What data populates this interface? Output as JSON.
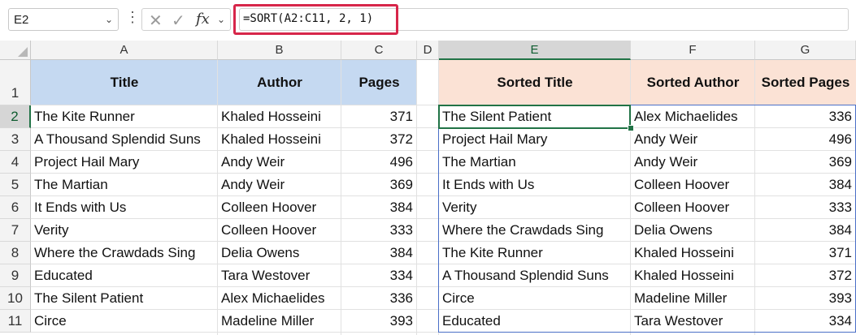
{
  "formula_bar": {
    "name_box": "E2",
    "formula": "=SORT(A2:C11, 2, 1)",
    "fx_label": "fx"
  },
  "columns": [
    "A",
    "B",
    "C",
    "D",
    "E",
    "F",
    "G"
  ],
  "rows": [
    "1",
    "2",
    "3",
    "4",
    "5",
    "6",
    "7",
    "8",
    "9",
    "10",
    "11"
  ],
  "source_table": {
    "headers": [
      "Title",
      "Author",
      "Pages"
    ],
    "rows": [
      [
        "The Kite Runner",
        "Khaled Hosseini",
        "371"
      ],
      [
        "A Thousand Splendid Suns",
        "Khaled Hosseini",
        "372"
      ],
      [
        "Project Hail Mary",
        "Andy Weir",
        "496"
      ],
      [
        "The Martian",
        "Andy Weir",
        "369"
      ],
      [
        "It Ends with Us",
        "Colleen Hoover",
        "384"
      ],
      [
        "Verity",
        "Colleen Hoover",
        "333"
      ],
      [
        "Where the Crawdads Sing",
        "Delia Owens",
        "384"
      ],
      [
        "Educated",
        "Tara Westover",
        "334"
      ],
      [
        "The Silent Patient",
        "Alex Michaelides",
        "336"
      ],
      [
        "Circe",
        "Madeline Miller",
        "393"
      ]
    ]
  },
  "sorted_table": {
    "headers": [
      "Sorted Title",
      "Sorted Author",
      "Sorted Pages"
    ],
    "rows": [
      [
        "The Silent Patient",
        "Alex Michaelides",
        "336"
      ],
      [
        "Project Hail Mary",
        "Andy Weir",
        "496"
      ],
      [
        "The Martian",
        "Andy Weir",
        "369"
      ],
      [
        "It Ends with Us",
        "Colleen Hoover",
        "384"
      ],
      [
        "Verity",
        "Colleen Hoover",
        "333"
      ],
      [
        "Where the Crawdads Sing",
        "Delia Owens",
        "384"
      ],
      [
        "The Kite Runner",
        "Khaled Hosseini",
        "371"
      ],
      [
        "A Thousand Splendid Suns",
        "Khaled Hosseini",
        "372"
      ],
      [
        "Circe",
        "Madeline Miller",
        "393"
      ],
      [
        "Educated",
        "Tara Westover",
        "334"
      ]
    ]
  },
  "colors": {
    "source_header_bg": "#c5d9f1",
    "sorted_header_bg": "#fbe2d5",
    "selection_green": "#217346",
    "spill_border": "#4a6fc7",
    "formula_highlight": "#d7264a"
  },
  "selected_cell": "E2"
}
